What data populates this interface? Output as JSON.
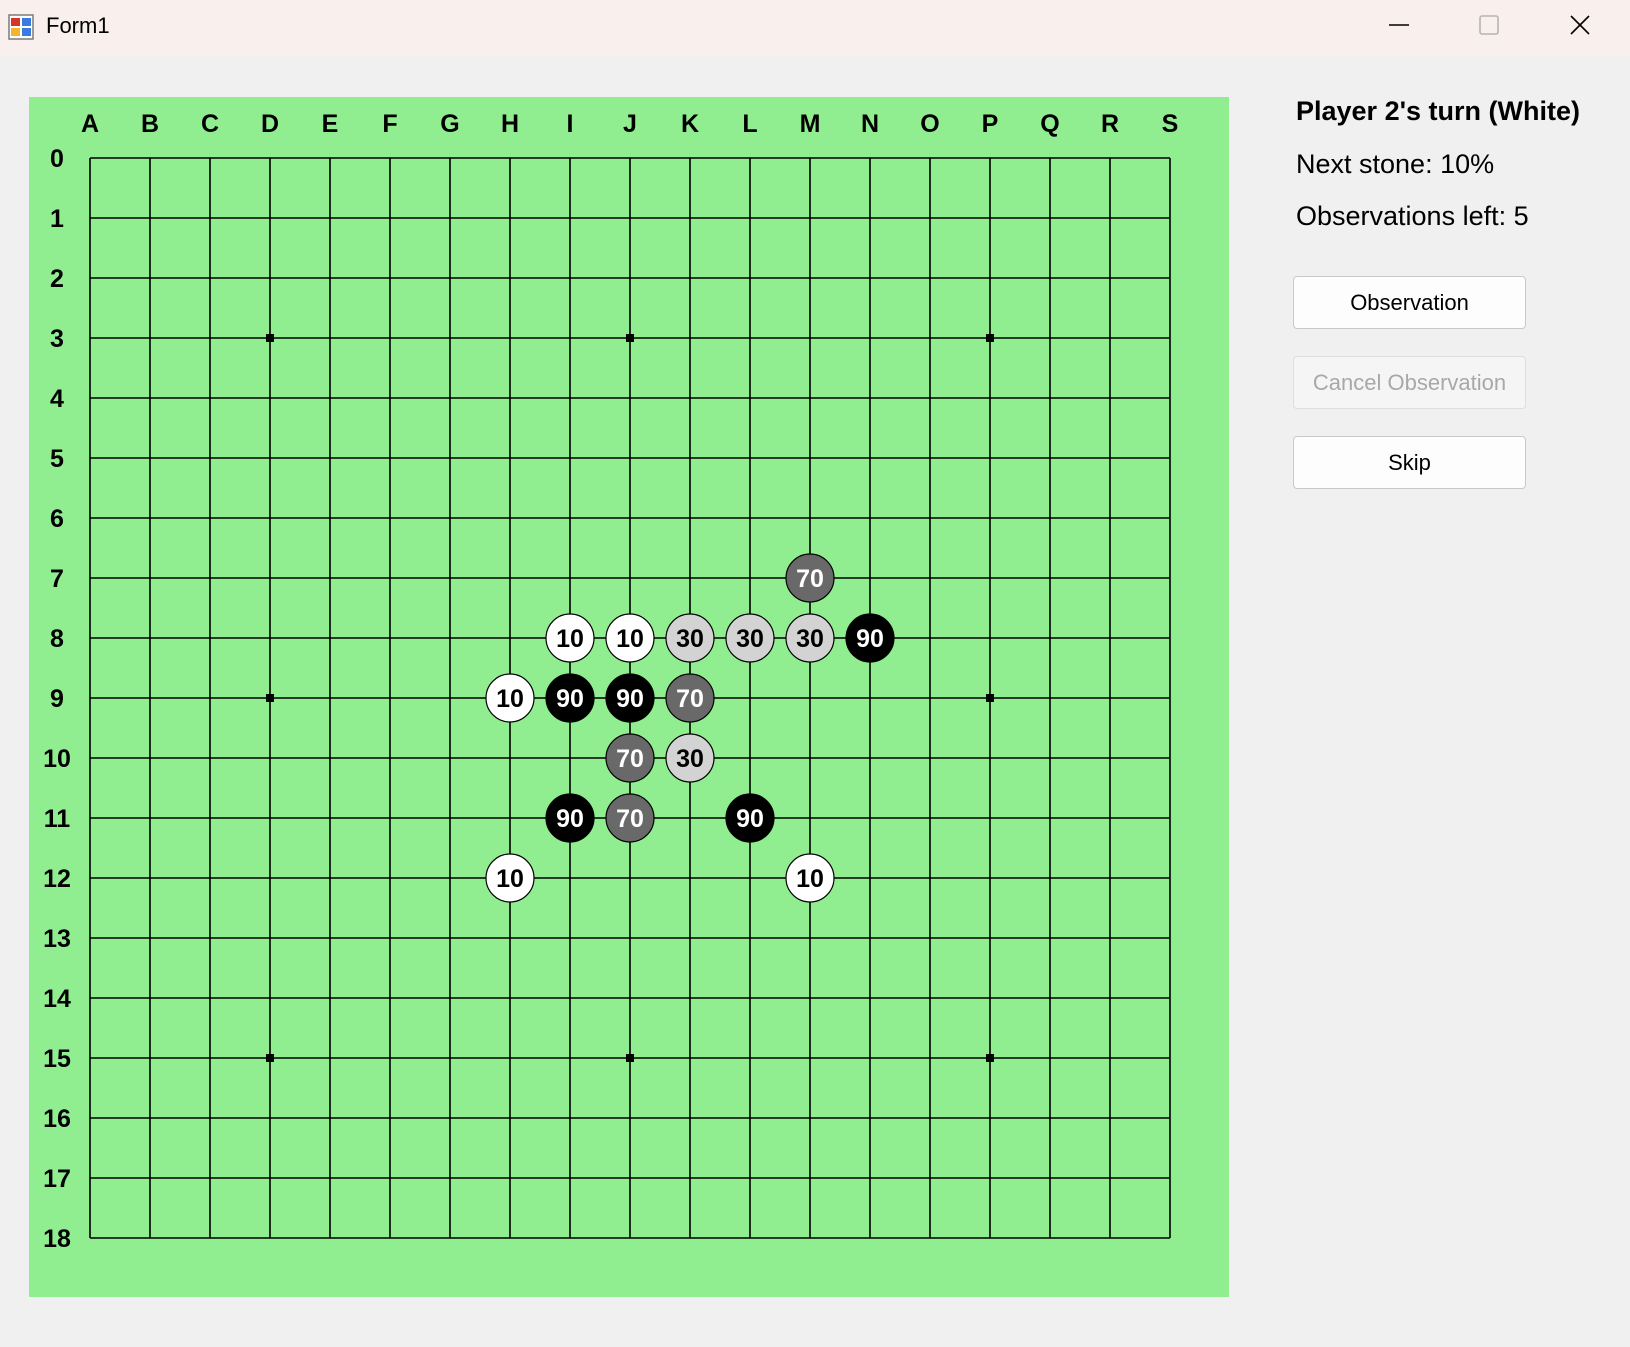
{
  "window": {
    "title": "Form1",
    "icons": {
      "app": "winforms-app-icon",
      "minimize": "minimize-icon",
      "maximize": "maximize-icon",
      "close": "close-icon"
    }
  },
  "board": {
    "size": 19,
    "columns": [
      "A",
      "B",
      "C",
      "D",
      "E",
      "F",
      "G",
      "H",
      "I",
      "J",
      "K",
      "L",
      "M",
      "N",
      "O",
      "P",
      "Q",
      "R",
      "S"
    ],
    "rows": [
      "0",
      "1",
      "2",
      "3",
      "4",
      "5",
      "6",
      "7",
      "8",
      "9",
      "10",
      "11",
      "12",
      "13",
      "14",
      "15",
      "16",
      "17",
      "18"
    ],
    "star_points": [
      [
        3,
        3
      ],
      [
        9,
        3
      ],
      [
        15,
        3
      ],
      [
        3,
        9
      ],
      [
        15,
        9
      ],
      [
        3,
        15
      ],
      [
        9,
        15
      ],
      [
        15,
        15
      ]
    ],
    "colors": {
      "background": "#90ee90",
      "line": "#000000"
    },
    "stones": [
      {
        "col": "M",
        "row": 7,
        "label": "70"
      },
      {
        "col": "I",
        "row": 8,
        "label": "10"
      },
      {
        "col": "J",
        "row": 8,
        "label": "10"
      },
      {
        "col": "K",
        "row": 8,
        "label": "30"
      },
      {
        "col": "L",
        "row": 8,
        "label": "30"
      },
      {
        "col": "M",
        "row": 8,
        "label": "30"
      },
      {
        "col": "N",
        "row": 8,
        "label": "90"
      },
      {
        "col": "H",
        "row": 9,
        "label": "10"
      },
      {
        "col": "I",
        "row": 9,
        "label": "90"
      },
      {
        "col": "J",
        "row": 9,
        "label": "90"
      },
      {
        "col": "K",
        "row": 9,
        "label": "70"
      },
      {
        "col": "J",
        "row": 10,
        "label": "70"
      },
      {
        "col": "K",
        "row": 10,
        "label": "30"
      },
      {
        "col": "I",
        "row": 11,
        "label": "90"
      },
      {
        "col": "J",
        "row": 11,
        "label": "70"
      },
      {
        "col": "L",
        "row": 11,
        "label": "90"
      },
      {
        "col": "H",
        "row": 12,
        "label": "10"
      },
      {
        "col": "M",
        "row": 12,
        "label": "10"
      }
    ],
    "stone_colors": {
      "10": "#ffffff",
      "30": "#d3d3d3",
      "70": "#696969",
      "90": "#000000"
    }
  },
  "status": {
    "turn": "Player 2's turn (White)",
    "next_stone": "Next stone: 10%",
    "observations_left": "Observations left: 5"
  },
  "buttons": {
    "observation": "Observation",
    "cancel_observation": "Cancel Observation",
    "skip": "Skip"
  }
}
